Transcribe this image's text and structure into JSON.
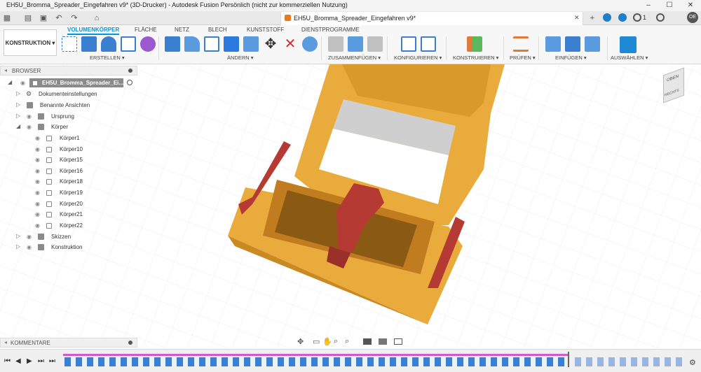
{
  "window": {
    "title": "EH5U_Bromma_Spreader_Eingefahren v9* (3D-Drucker) - Autodesk Fusion Persönlich (nicht zur kommerziellen Nutzung)",
    "minimize": "–",
    "maximize": "☐",
    "close": "✕"
  },
  "document_tab": {
    "label": "EH5U_Bromma_Spreader_Eingefahren v9*",
    "close": "✕"
  },
  "quickbar": {
    "job_count": "1",
    "user_initials": "OE"
  },
  "toolbar": {
    "workspace": "KONSTRUKTION ▾",
    "tabs": [
      "VOLUMENKÖRPER",
      "FLÄCHE",
      "NETZ",
      "BLECH",
      "KUNSTSTOFF",
      "DIENSTPROGRAMME"
    ],
    "groups": [
      "ERSTELLEN ▾",
      "ÄNDERN ▾",
      "ZUSAMMENFÜGEN ▾",
      "KONFIGURIEREN ▾",
      "KONSTRUIEREN ▾",
      "PRÜFEN ▾",
      "EINFÜGEN ▾",
      "AUSWÄHLEN ▾"
    ]
  },
  "browser": {
    "title": "BROWSER",
    "root": "EH5U_Bromma_Spreader_Ei...",
    "items": [
      "Dokumenteinstellungen",
      "Benannte Ansichten",
      "Ursprung",
      "Körper",
      "Skizzen",
      "Konstruktion"
    ],
    "bodies": [
      "Körper1",
      "Körper10",
      "Körper15",
      "Körper16",
      "Körper18",
      "Körper19",
      "Körper20",
      "Körper21",
      "Körper22"
    ]
  },
  "viewcube": {
    "top": "OBEN",
    "right": "RECHTS"
  },
  "comments": {
    "title": "KOMMENTARE"
  },
  "colors": {
    "accent": "#0696d7",
    "part_body": "#e9ac3c",
    "part_red": "#b53a33",
    "timeline_bar": "#d05ad0"
  }
}
